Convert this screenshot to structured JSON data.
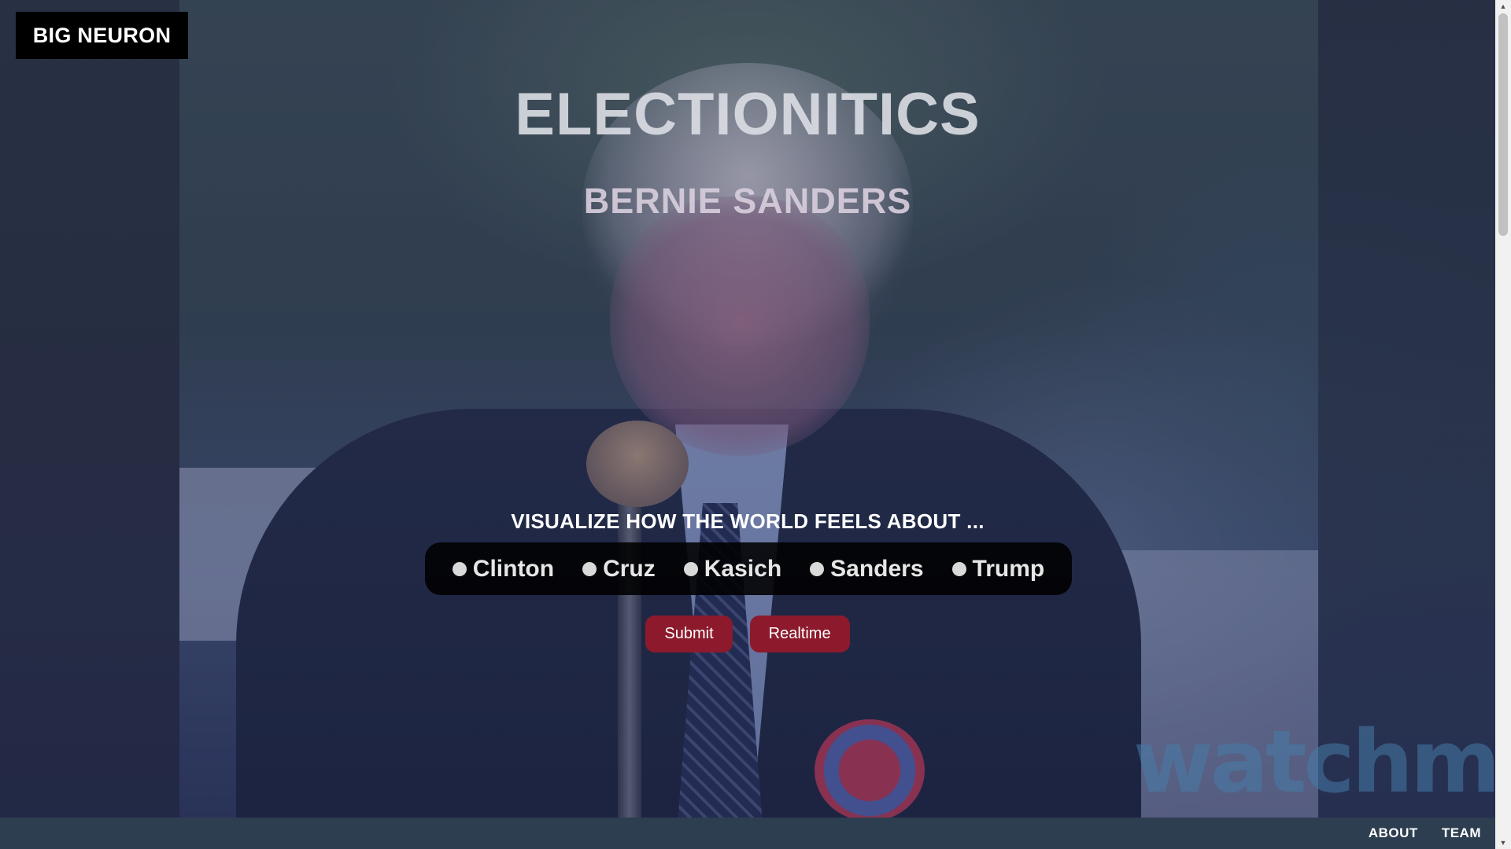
{
  "brand": {
    "logo_text": "BIG NEURON"
  },
  "hero": {
    "title": "ELECTIONITICS",
    "subtitle": "BERNIE SANDERS"
  },
  "selector": {
    "prompt": "VISUALIZE HOW THE WORLD FEELS ABOUT ...",
    "candidates": [
      {
        "label": "Clinton"
      },
      {
        "label": "Cruz"
      },
      {
        "label": "Kasich"
      },
      {
        "label": "Sanders"
      },
      {
        "label": "Trump"
      }
    ]
  },
  "actions": {
    "submit_label": "Submit",
    "realtime_label": "Realtime"
  },
  "footer": {
    "about_label": "ABOUT",
    "team_label": "TEAM"
  },
  "background": {
    "watermark_text": "watchmojo"
  },
  "colors": {
    "button_bg": "#8c1a2c",
    "footer_bg": "#2d3e50",
    "logo_bg": "#000000"
  }
}
